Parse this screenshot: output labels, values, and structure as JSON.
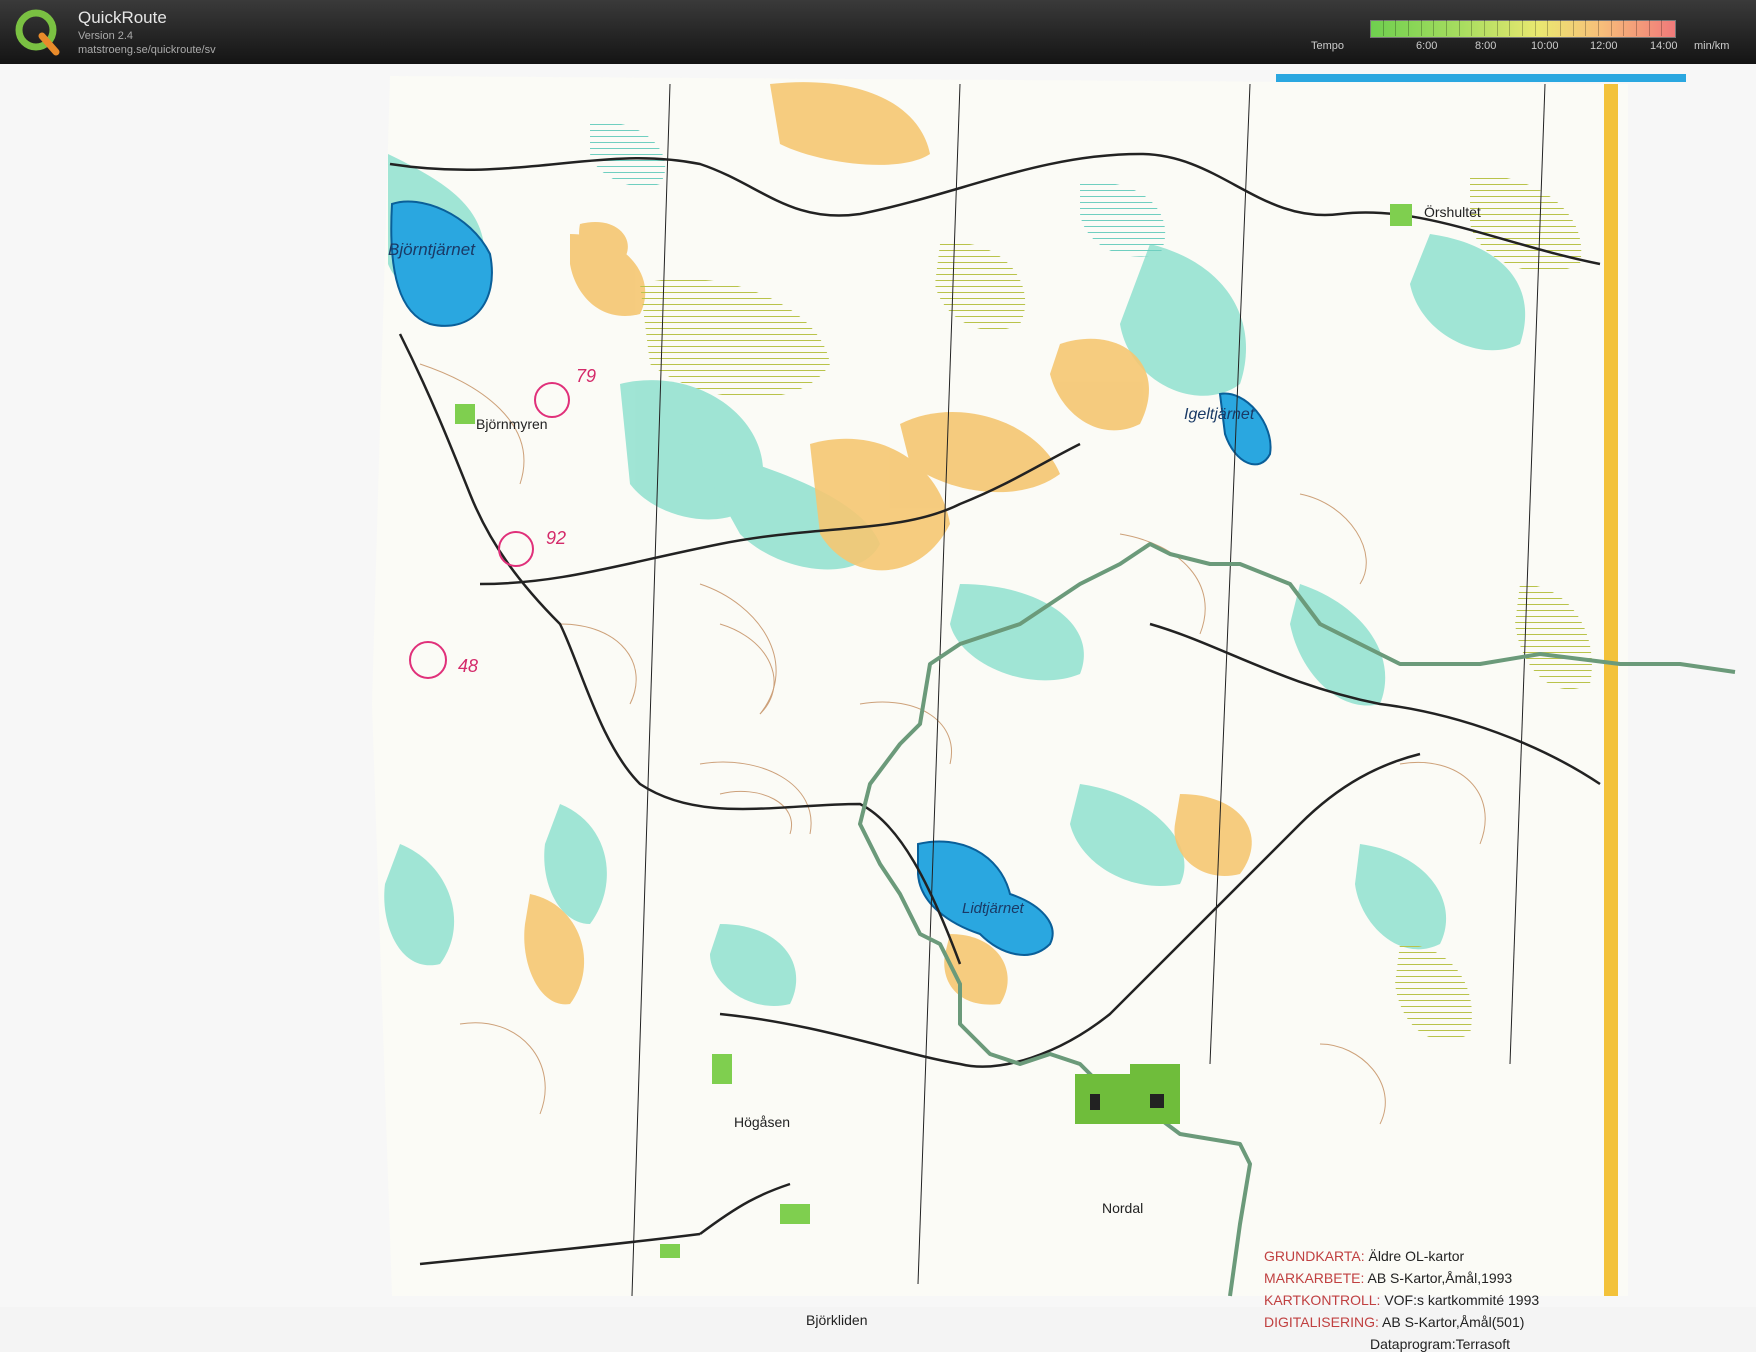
{
  "header": {
    "app_title": "QuickRoute",
    "version": "Version 2.4",
    "url": "matstroeng.se/quickroute/sv",
    "tempo_label": "Tempo",
    "tempo_scale": [
      "6:00",
      "8:00",
      "10:00",
      "12:00",
      "14:00"
    ],
    "tempo_unit": "min/km",
    "icon": "quickroute-logo-icon"
  },
  "map": {
    "place_names": {
      "bjorntjarnet": "Björntjärnet",
      "bjornmyren": "Björnmyren",
      "orshultet": "Örshultet",
      "igeltjarnet": "Igeltjärnet",
      "lidtjarnet": "Lidtjärnet",
      "hogasen": "Högåsen",
      "nordal": "Nordal",
      "bjorkliden": "Björkliden"
    },
    "control_numbers": [
      "79",
      "92",
      "48"
    ],
    "credits": [
      {
        "key": "GRUNDKARTA:",
        "value": "Äldre OL-kartor"
      },
      {
        "key": "MARKARBETE:",
        "value": "AB S-Kartor,Åmål,1993"
      },
      {
        "key": "KARTKONTROLL:",
        "value": "VOF:s kartkommité 1993"
      },
      {
        "key": "DIGITALISERING:",
        "value": "AB S-Kartor,Åmål(501)"
      },
      {
        "key": "",
        "value": "Dataprogram:Terrasoft"
      }
    ],
    "colors": {
      "water": "#2aa7e0",
      "vegetation_green": "#7fdccb",
      "open_yellow": "#f6c56a",
      "route": "#6b9a7a",
      "control_circle": "#e0307a",
      "contour": "#b97a45"
    }
  }
}
